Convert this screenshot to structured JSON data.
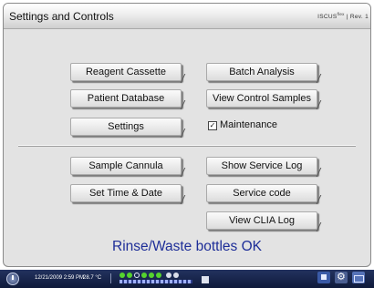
{
  "window": {
    "title": "Settings and Controls",
    "brand": "ISCUS",
    "brand_sup": "flex",
    "brand_suffix": "| Rev. 1"
  },
  "buttons": {
    "reagent_cassette": "Reagent Cassette",
    "batch_analysis": "Batch Analysis",
    "patient_database": "Patient Database",
    "view_control_samples": "View Control Samples",
    "settings": "Settings",
    "sample_cannula": "Sample Cannula",
    "show_service_log": "Show Service Log",
    "set_time_date": "Set Time & Date",
    "service_code": "Service code",
    "view_clia_log": "View CLIA Log"
  },
  "maintenance": {
    "label": "Maintenance",
    "checked": true
  },
  "status_message": "Rinse/Waste bottles OK",
  "taskbar": {
    "datetime": "12/21/2009 2:59 PM",
    "temperature": "28.7 °C"
  },
  "colors": {
    "status_text": "#1e2e98",
    "taskbar": "#1a2650",
    "indicator_green": "#55d32e"
  }
}
